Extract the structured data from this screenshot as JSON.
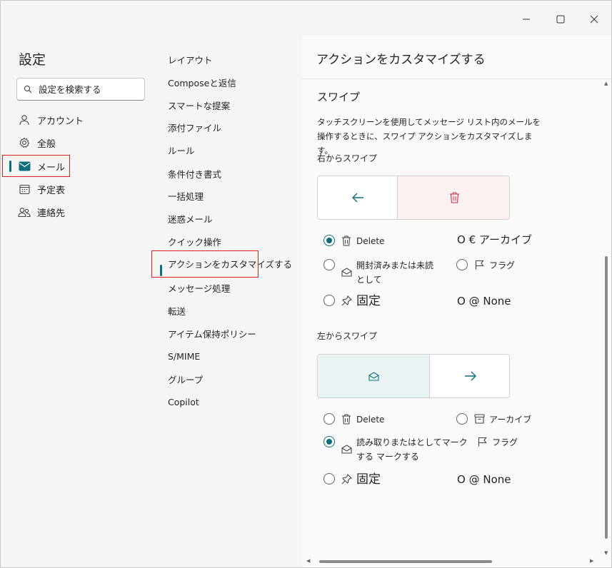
{
  "window": {
    "controls": [
      "minimize",
      "maximize",
      "close"
    ]
  },
  "left": {
    "title": "設定",
    "search": {
      "placeholder": "設定を検索する",
      "icon": "search-icon"
    },
    "items": [
      {
        "label": "アカウント",
        "icon": "person-icon"
      },
      {
        "label": "全般",
        "icon": "gear-icon"
      },
      {
        "label": "メール",
        "icon": "mail-icon",
        "active": true
      },
      {
        "label": "予定表",
        "icon": "calendar-icon"
      },
      {
        "label": "連絡先",
        "icon": "people-icon"
      }
    ]
  },
  "middle": {
    "items": [
      {
        "label": "レイアウト"
      },
      {
        "label": "Composeと返信"
      },
      {
        "label": "スマートな提案"
      },
      {
        "label": "添付ファイル"
      },
      {
        "label": "ルール"
      },
      {
        "label": "条件付き書式"
      },
      {
        "label": "一括処理"
      },
      {
        "label": "迷惑メール"
      },
      {
        "label": "クイック操作"
      },
      {
        "label": "アクションをカスタマイズする",
        "active": true
      },
      {
        "label": "メッセージ処理"
      },
      {
        "label": "転送"
      },
      {
        "label": "アイテム保持ポリシー"
      },
      {
        "label": "S/MIME"
      },
      {
        "label": "グループ"
      },
      {
        "label": "Copilot"
      }
    ]
  },
  "right": {
    "title": "アクションをカスタマイズする",
    "section_title": "スワイプ",
    "description": "タッチスクリーンを使用してメッセージ リスト内のメールを操作するときに、スワイプ アクションをカスタマイズします。",
    "swipe_right": {
      "label": "右からスワイプ",
      "options": {
        "delete": "Delete",
        "archive": "O € アーカイブ",
        "read_unread": "開封済みまたは未読として",
        "flag": "フラグ",
        "pin": "固定",
        "none": "O @ None"
      },
      "selected": "delete"
    },
    "swipe_left": {
      "label": "左からスワイプ",
      "options": {
        "delete": "Delete",
        "archive": "アーカイブ",
        "read_unread": "読み取りまたはとしてマークする マークする",
        "flag": "フラグ",
        "pin": "固定",
        "none": "O @ None"
      },
      "selected": "read_unread"
    }
  },
  "colors": {
    "accent": "#0c6e7a",
    "delete_preview_bg": "#fbf1f1",
    "delete_icon": "#c4314b",
    "read_preview_bg": "#eaf3f4"
  }
}
